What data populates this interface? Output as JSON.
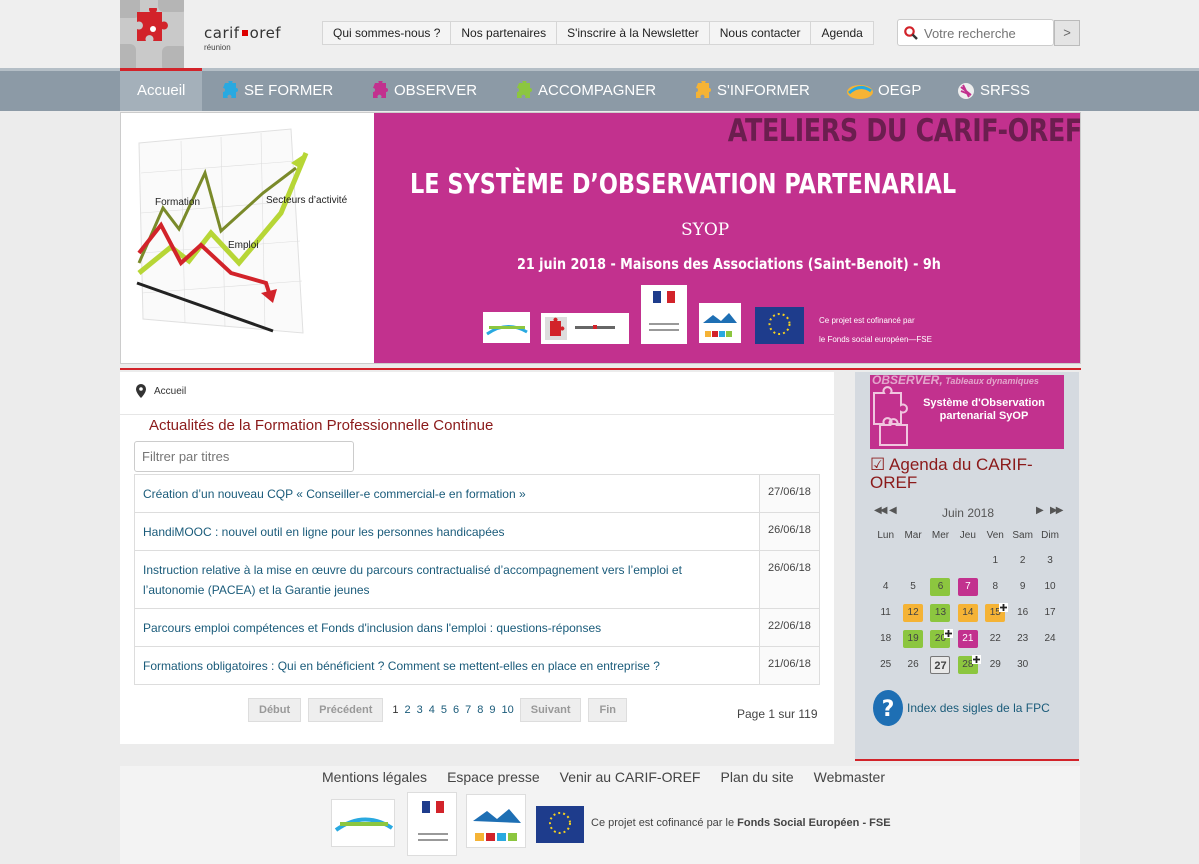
{
  "header": {
    "logo_text_left": "carif",
    "logo_text_right": "oref",
    "logo_sub": "réunion",
    "top_links": [
      "Qui sommes-nous ?",
      "Nos partenaires",
      "S'inscrire à la Newsletter",
      "Nous contacter",
      "Agenda"
    ],
    "search_placeholder": "Votre recherche",
    "search_button": ">"
  },
  "mainnav": {
    "items": [
      "Accueil",
      "SE FORMER",
      "OBSERVER",
      "ACCOMPAGNER",
      "S'INFORMER",
      "OEGP",
      "SRFSS"
    ],
    "icon_colors": [
      "",
      "#29a9e0",
      "#c2318e",
      "#8cc63f",
      "#f5b335",
      "#f5b335",
      "#8c9aa6"
    ]
  },
  "banner": {
    "ateliers": "ATELIERS DU CARIF-OREF",
    "title": "LE SYSTÈME D’OBSERVATION PARTENARIAL",
    "syop": "SYOP",
    "date": "21 juin 2018 - Maisons des Associations (Saint-Benoit) - 9h",
    "note_line1": "Ce projet est cofinancé par",
    "note_line2": "le Fonds social européen—FSE",
    "chart_labels": [
      "Formation",
      "Secteurs d’activité",
      "Emploi"
    ]
  },
  "content": {
    "breadcrumb": "Accueil",
    "title": "Actualités de la Formation Professionnelle Continue",
    "filter_placeholder": "Filtrer par titres",
    "news": [
      {
        "title": "Création d’un nouveau CQP « Conseiller-e commercial-e en formation »",
        "date": "27/06/18"
      },
      {
        "title": "HandiMOOC : nouvel outil en ligne pour les personnes handicapées",
        "date": "26/06/18"
      },
      {
        "title": "Instruction relative à la mise en œuvre du parcours contractualisé d’accompagnement vers l’emploi et l’autonomie (PACEA) et la Garantie jeunes",
        "date": "26/06/18"
      },
      {
        "title": "Parcours emploi compétences et Fonds d'inclusion dans l'emploi : questions-réponses",
        "date": "22/06/18"
      },
      {
        "title": "Formations obligatoires : Qui en bénéficient ? Comment se mettent-elles en place en entreprise ?",
        "date": "21/06/18"
      }
    ],
    "pager": {
      "first": "Début",
      "prev": "Précédent",
      "pages": [
        "1",
        "2",
        "3",
        "4",
        "5",
        "6",
        "7",
        "8",
        "9",
        "10"
      ],
      "next": "Suivant",
      "last": "Fin",
      "info": "Page 1 sur 119"
    }
  },
  "sidebar": {
    "banner_top": "OBSERVER,",
    "banner_top_small": " Tableaux dynamiques",
    "banner_title": "Système d'Observation partenarial SyOP",
    "agenda_title": "☑ Agenda du CARIF-OREF",
    "calendar": {
      "month": "Juin 2018",
      "weekdays": [
        "Lun",
        "Mar",
        "Mer",
        "Jeu",
        "Ven",
        "Sam",
        "Dim"
      ],
      "weeks": [
        [
          {
            "d": ""
          },
          {
            "d": ""
          },
          {
            "d": ""
          },
          {
            "d": ""
          },
          {
            "d": "1"
          },
          {
            "d": "2"
          },
          {
            "d": "3"
          }
        ],
        [
          {
            "d": "4"
          },
          {
            "d": "5"
          },
          {
            "d": "6",
            "c": "g"
          },
          {
            "d": "7",
            "c": "p"
          },
          {
            "d": "8"
          },
          {
            "d": "9"
          },
          {
            "d": "10"
          }
        ],
        [
          {
            "d": "11"
          },
          {
            "d": "12",
            "c": "o"
          },
          {
            "d": "13",
            "c": "g"
          },
          {
            "d": "14",
            "c": "o"
          },
          {
            "d": "15",
            "c": "o",
            "plus": true
          },
          {
            "d": "16"
          },
          {
            "d": "17"
          }
        ],
        [
          {
            "d": "18"
          },
          {
            "d": "19",
            "c": "g"
          },
          {
            "d": "20",
            "c": "g",
            "plus": true
          },
          {
            "d": "21",
            "c": "p"
          },
          {
            "d": "22"
          },
          {
            "d": "23"
          },
          {
            "d": "24"
          }
        ],
        [
          {
            "d": "25"
          },
          {
            "d": "26"
          },
          {
            "d": "27",
            "c": "today"
          },
          {
            "d": "28",
            "c": "g",
            "plus": true
          },
          {
            "d": "29"
          },
          {
            "d": "30"
          },
          {
            "d": ""
          }
        ]
      ]
    },
    "faq_link": "Index des sigles de la FPC"
  },
  "footer": {
    "links": [
      "Mentions légales",
      "Espace presse",
      "Venir au CARIF-OREF",
      "Plan du site",
      "Webmaster"
    ],
    "note_prefix": "Ce projet est cofinancé par le ",
    "note_bold": "Fonds Social Européen - FSE"
  }
}
